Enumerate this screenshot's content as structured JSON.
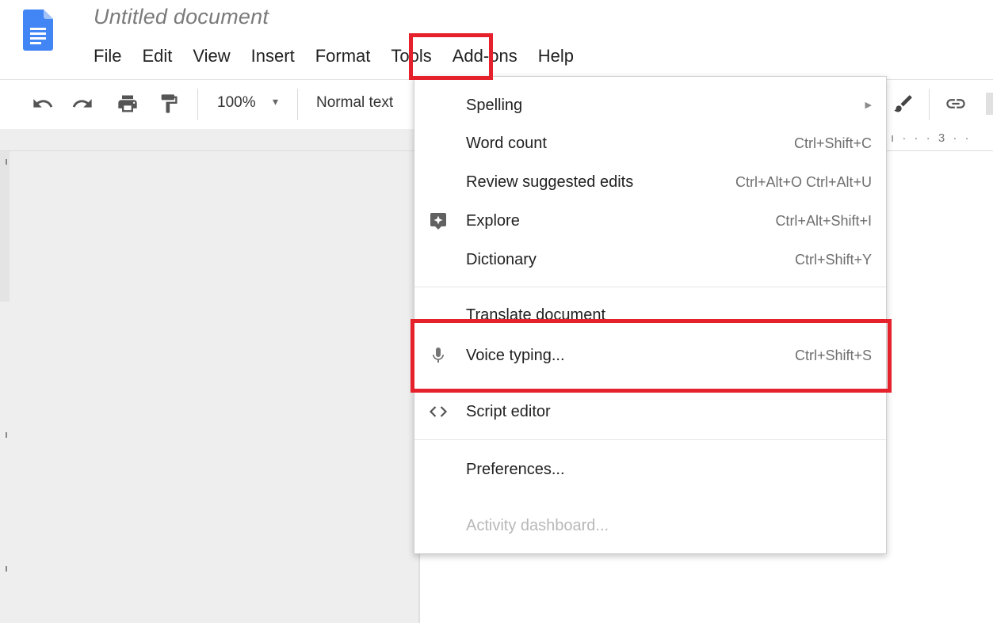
{
  "document": {
    "title": "Untitled document"
  },
  "menubar": {
    "items": [
      "File",
      "Edit",
      "View",
      "Insert",
      "Format",
      "Tools",
      "Add-ons",
      "Help"
    ]
  },
  "toolbar": {
    "undo_icon": "undo-icon",
    "redo_icon": "redo-icon",
    "print_icon": "print-icon",
    "paint_format_icon": "paint-format-icon",
    "zoom": "100%",
    "zoom_caret": "▾",
    "paragraph_style": "Normal text",
    "highlight_icon": "pen-icon",
    "link_icon": "link-icon"
  },
  "ruler": {
    "ticks": "ı · · · 3 · ·"
  },
  "tools_menu": {
    "items": [
      {
        "label": "Spelling",
        "shortcut": "",
        "submenu": true,
        "icon": ""
      },
      {
        "label": "Word count",
        "shortcut": "Ctrl+Shift+C",
        "icon": ""
      },
      {
        "label": "Review suggested edits",
        "shortcut": "Ctrl+Alt+O Ctrl+Alt+U",
        "icon": ""
      },
      {
        "label": "Explore",
        "shortcut": "Ctrl+Alt+Shift+I",
        "icon": "explore-icon"
      },
      {
        "label": "Dictionary",
        "shortcut": "Ctrl+Shift+Y",
        "icon": ""
      },
      {
        "label": "Translate document",
        "shortcut": "",
        "icon": ""
      },
      {
        "label": "Voice typing...",
        "shortcut": "Ctrl+Shift+S",
        "icon": "microphone-icon"
      },
      {
        "label": "Script editor",
        "shortcut": "",
        "icon": "code-icon"
      },
      {
        "label": "Preferences...",
        "shortcut": "",
        "icon": ""
      },
      {
        "label": "Activity dashboard...",
        "shortcut": "",
        "icon": "",
        "disabled": true
      }
    ]
  },
  "colors": {
    "highlight_red": "#e5212b",
    "docs_blue": "#4285f4",
    "menu_text": "#222222",
    "shortcut_text": "#6f6f6f",
    "disabled_text": "#b8b8b8",
    "canvas_gray": "#eeeeee"
  }
}
